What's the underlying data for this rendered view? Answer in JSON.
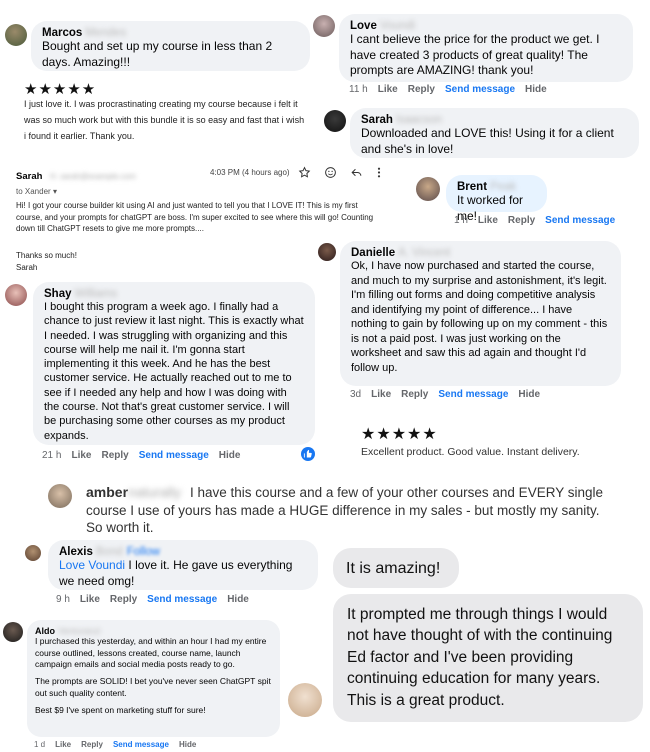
{
  "marcos": {
    "name": "Marcos",
    "surname": "Mendes",
    "text": "Bought and set up my course in less than 2 days. Amazing!!!"
  },
  "review1": {
    "stars": "★★★★★",
    "text": "I just love it. I was procrastinating creating my course because i felt it was so much work but with this bundle it is so easy and fast that i wish i found it earlier. Thank you."
  },
  "email": {
    "sender": "Sarah",
    "sender_blur": "H. sarah@example.com",
    "time": "4:03 PM (4 hours ago)",
    "to": "to Xander",
    "body1": "Hi!  I got your course builder kit using AI and just wanted to tell you that I LOVE IT!  This is my first course, and your prompts for chatGPT are boss.   I'm super excited to see where this will go!  Counting down till ChatGPT resets to give me more prompts....",
    "thanks": "Thanks so much!",
    "sign": "Sarah"
  },
  "shay": {
    "name": "Shay",
    "surname": "Williams",
    "text": "I bought this program a week ago. I finally had a chance to just review it last night. This is exactly what I needed. I was struggling with organizing and this course will help me nail it. I'm gonna start implementing it this week. And he has the best customer service. He actually reached out to me to see if I needed any help and how I was doing with the course. Not that's great customer service. I will be purchasing some other courses as my product expands.",
    "time": "21 h",
    "like": "Like",
    "reply": "Reply",
    "send": "Send message",
    "hide": "Hide"
  },
  "love": {
    "name": "Love",
    "surname": "Voundi",
    "text": "I cant believe the price for the product we get. I have created 3 products of great quality! The prompts are AMAZING! thank you!",
    "time": "11 h",
    "like": "Like",
    "reply": "Reply",
    "send": "Send message",
    "hide": "Hide"
  },
  "sarah2": {
    "name": "Sarah",
    "surname": "Isaacson",
    "text": "Downloaded and LOVE this! Using it for a client and she's in love!"
  },
  "brent": {
    "name": "Brent",
    "surname": "Peak",
    "text": "It worked for me!",
    "time": "1 h",
    "like": "Like",
    "reply": "Reply",
    "send": "Send message"
  },
  "danielle": {
    "name": "Danielle",
    "surname": "A. Vincent",
    "text": "Ok, I have now purchased and started the course, and much to my surprise and astonishment, it's legit. I'm filling out forms and doing competitive analysis and identifying my point of difference... I have nothing to gain by following up on my comment - this is not a paid post. I was just working on the worksheet and saw this ad again and thought I'd follow up.",
    "time": "3d",
    "like": "Like",
    "reply": "Reply",
    "send": "Send message",
    "hide": "Hide"
  },
  "review2": {
    "stars": "★★★★★",
    "text": "Excellent product. Good value. Instant delivery."
  },
  "amber": {
    "name": "amber",
    "name_blur": "naturally",
    "text": "I have this course and a few of your other courses and EVERY single course I use of yours has made a HUGE difference in my sales - but mostly my sanity. So worth it."
  },
  "alexis": {
    "name": "Alexis",
    "surname": "Bond",
    "follow": "Follow",
    "mention": "Love Voundi",
    "text": " I love it. He gave us everything we need omg!",
    "time": "9 h",
    "like": "Like",
    "reply": "Reply",
    "send": "Send message",
    "hide": "Hide"
  },
  "aldo": {
    "name": "Aldo",
    "surname": "Venturanzi",
    "p1": "I purchased this yesterday, and within an hour I had my entire course outlined, lessons created, course name, launch campaign emails and social media posts ready to go.",
    "p2": "The prompts are SOLID! I bet you've never seen ChatGPT spit out such quality content.",
    "p3": "Best $9 I've spent on marketing stuff for sure!",
    "time": "1 d",
    "like": "Like",
    "reply": "Reply",
    "send": "Send message",
    "hide": "Hide"
  },
  "imsg": {
    "m1": "It is amazing!",
    "m2": "It prompted me through things I would not have thought of with the continuing Ed factor and I've been providing continuing education for many years. This is a great product."
  },
  "colors": {
    "link": "#1877f2",
    "bubble": "#f0f2f5",
    "imsg": "#e9e9eb"
  }
}
